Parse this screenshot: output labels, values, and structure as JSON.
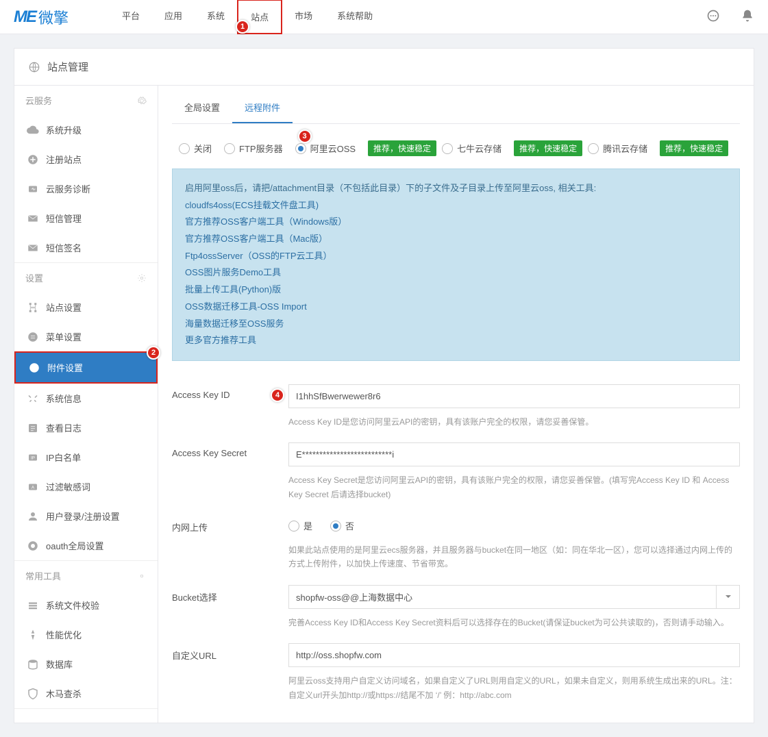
{
  "logo": {
    "mark": "ME",
    "text": "微擎"
  },
  "topnav": [
    "平台",
    "应用",
    "系统",
    "站点",
    "市场",
    "系统帮助"
  ],
  "page_title": "站点管理",
  "sidebar": {
    "groups": [
      {
        "title": "云服务",
        "items": [
          {
            "label": "系统升级"
          },
          {
            "label": "注册站点"
          },
          {
            "label": "云服务诊断"
          },
          {
            "label": "短信管理"
          },
          {
            "label": "短信签名"
          }
        ]
      },
      {
        "title": "设置",
        "items": [
          {
            "label": "站点设置"
          },
          {
            "label": "菜单设置"
          },
          {
            "label": "附件设置",
            "active": true
          },
          {
            "label": "系统信息"
          },
          {
            "label": "查看日志"
          },
          {
            "label": "IP白名单"
          },
          {
            "label": "过滤敏感词"
          },
          {
            "label": "用户登录/注册设置"
          },
          {
            "label": "oauth全局设置"
          }
        ]
      },
      {
        "title": "常用工具",
        "items": [
          {
            "label": "系统文件校验"
          },
          {
            "label": "性能优化"
          },
          {
            "label": "数据库"
          },
          {
            "label": "木马查杀"
          }
        ]
      }
    ]
  },
  "tabs": [
    {
      "label": "全局设置"
    },
    {
      "label": "远程附件",
      "active": true
    }
  ],
  "remote_options": {
    "items": [
      {
        "label": "关闭"
      },
      {
        "label": "FTP服务器"
      },
      {
        "label": "阿里云OSS",
        "checked": true,
        "badge": "推荐，快速稳定"
      },
      {
        "label": "七牛云存储",
        "badge": "推荐，快速稳定"
      },
      {
        "label": "腾讯云存储",
        "badge": "推荐，快速稳定"
      }
    ]
  },
  "infobox": {
    "line1": "启用阿里oss后，请把/attachment目录（不包括此目录）下的子文件及子目录上传至阿里云oss, 相关工具:",
    "links": [
      "cloudfs4oss(ECS挂载文件盘工具)",
      "官方推荐OSS客户端工具（Windows版）",
      "官方推荐OSS客户端工具（Mac版）",
      "Ftp4ossServer（OSS的FTP云工具）",
      "OSS图片服务Demo工具",
      "批量上传工具(Python)版",
      "OSS数据迁移工具-OSS Import",
      "海量数据迁移至OSS服务",
      "更多官方推荐工具"
    ]
  },
  "form": {
    "access_key_id": {
      "label": "Access Key ID",
      "value": "I1hhSfBwerwewer8r6",
      "help": "Access Key ID是您访问阿里云API的密钥，具有该账户完全的权限，请您妥善保管。"
    },
    "access_key_secret": {
      "label": "Access Key Secret",
      "value": "E**************************i",
      "help": "Access Key Secret是您访问阿里云API的密钥，具有该账户完全的权限，请您妥善保管。(填写完Access Key ID 和 Access Key Secret 后请选择bucket)"
    },
    "internal": {
      "label": "内网上传",
      "yes": "是",
      "no": "否",
      "help": "如果此站点使用的是阿里云ecs服务器，并且服务器与bucket在同一地区（如：同在华北一区），您可以选择通过内网上传的方式上传附件，以加快上传速度、节省带宽。"
    },
    "bucket": {
      "label": "Bucket选择",
      "value": "shopfw-oss@@上海数据中心",
      "help": "完善Access Key ID和Access Key Secret资料后可以选择存在的Bucket(请保证bucket为可公共读取的)，否则请手动输入。"
    },
    "custom_url": {
      "label": "自定义URL",
      "value": "http://oss.shopfw.com",
      "help": "阿里云oss支持用户自定义访问域名，如果自定义了URL则用自定义的URL，如果未自定义，则用系统生成出来的URL。注：自定义url开头加http://或https://结尾不加   ‘/’  例：http://abc.com"
    }
  },
  "nums": {
    "n1": "1",
    "n2": "2",
    "n3": "3",
    "n4": "4"
  }
}
